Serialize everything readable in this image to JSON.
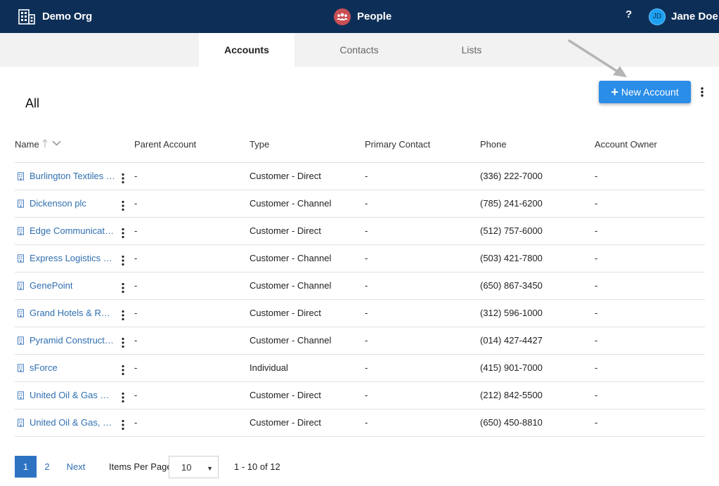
{
  "header": {
    "org_name": "Demo Org",
    "org_icon": "building-icon",
    "app_name": "People",
    "app_icon": "people-icon",
    "app_icon_color": "#c94f55",
    "help_label": "?",
    "user_initials": "JD",
    "user_name": "Jane Doe",
    "bar_color": "#0d2f57"
  },
  "tabs": [
    {
      "label": "Accounts",
      "active": true
    },
    {
      "label": "Contacts",
      "active": false
    },
    {
      "label": "Lists",
      "active": false
    }
  ],
  "view": {
    "title": "All",
    "new_button_label": "New Account",
    "accent_color": "#2a8de8"
  },
  "table": {
    "columns": [
      "Name",
      "Parent Account",
      "Type",
      "Primary Contact",
      "Phone",
      "Account Owner"
    ],
    "rows": [
      {
        "name": "Burlington Textiles Corp of America",
        "parent": "-",
        "type": "Customer - Direct",
        "contact": "-",
        "phone": "(336) 222-7000",
        "owner": "-"
      },
      {
        "name": "Dickenson plc",
        "parent": "-",
        "type": "Customer - Channel",
        "contact": "-",
        "phone": "(785) 241-6200",
        "owner": "-"
      },
      {
        "name": "Edge Communications",
        "parent": "-",
        "type": "Customer - Direct",
        "contact": "-",
        "phone": "(512) 757-6000",
        "owner": "-"
      },
      {
        "name": "Express Logistics and Transport",
        "parent": "-",
        "type": "Customer - Channel",
        "contact": "-",
        "phone": "(503) 421-7800",
        "owner": "-"
      },
      {
        "name": "GenePoint",
        "parent": "-",
        "type": "Customer - Channel",
        "contact": "-",
        "phone": "(650) 867-3450",
        "owner": "-"
      },
      {
        "name": "Grand Hotels & Resorts Ltd",
        "parent": "-",
        "type": "Customer - Direct",
        "contact": "-",
        "phone": "(312) 596-1000",
        "owner": "-"
      },
      {
        "name": "Pyramid Construction Inc.",
        "parent": "-",
        "type": "Customer - Channel",
        "contact": "-",
        "phone": "(014) 427-4427",
        "owner": "-"
      },
      {
        "name": "sForce",
        "parent": "-",
        "type": "Individual",
        "contact": "-",
        "phone": "(415) 901-7000",
        "owner": "-"
      },
      {
        "name": "United Oil & Gas Corp.",
        "parent": "-",
        "type": "Customer - Direct",
        "contact": "-",
        "phone": "(212) 842-5500",
        "owner": "-"
      },
      {
        "name": "United Oil & Gas, Singapore",
        "parent": "-",
        "type": "Customer - Direct",
        "contact": "-",
        "phone": "(650) 450-8810",
        "owner": "-"
      }
    ]
  },
  "pagination": {
    "pages": [
      "1",
      "2"
    ],
    "current_page": "1",
    "next_label": "Next",
    "items_per_page_label": "Items Per Page",
    "items_per_page_value": "10",
    "range_text": "1 - 10 of 12"
  }
}
